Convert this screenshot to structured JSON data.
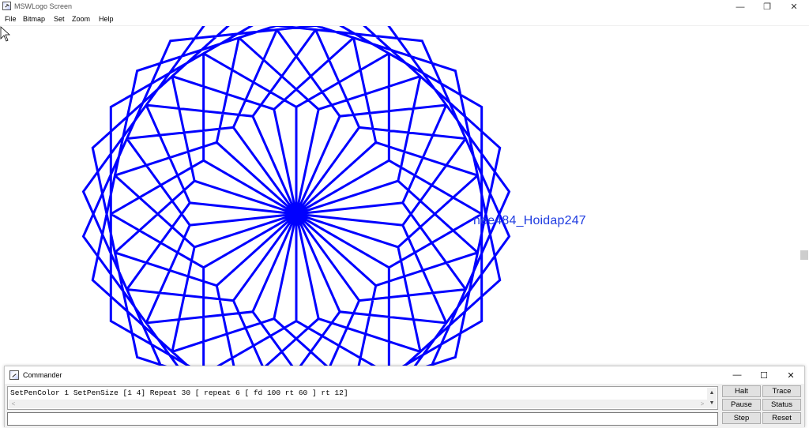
{
  "window": {
    "title": "MSWLogo Screen",
    "minimize_glyph": "—",
    "maximize_glyph": "❐",
    "close_glyph": "✕"
  },
  "menu": {
    "items": [
      "File",
      "Bitmap",
      "Set",
      "Zoom",
      "Help"
    ]
  },
  "canvas": {
    "label_text": "nee484_Hoidap247",
    "label_color": "#1f3ce0",
    "drawing": {
      "pen_color": "#0000ff",
      "repeat_outer": 30,
      "repeat_inner": 6,
      "forward": 100,
      "inner_turn": 60,
      "outer_turn": 12
    }
  },
  "commander": {
    "title": "Commander",
    "minimize_glyph": "—",
    "maximize_glyph": "☐",
    "close_glyph": "✕",
    "history": [
      "SetPenColor 1 SetPenSize [1 4] Repeat 30 [ repeat 6 [ fd 100 rt 60 ] rt 12]"
    ],
    "input_value": "",
    "buttons": {
      "halt": "Halt",
      "trace": "Trace",
      "pause": "Pause",
      "status": "Status",
      "step": "Step",
      "reset": "Reset"
    },
    "scroll_left_glyph": "<",
    "scroll_right_glyph": ">",
    "scroll_up_glyph": "▲",
    "scroll_down_glyph": "▼"
  }
}
